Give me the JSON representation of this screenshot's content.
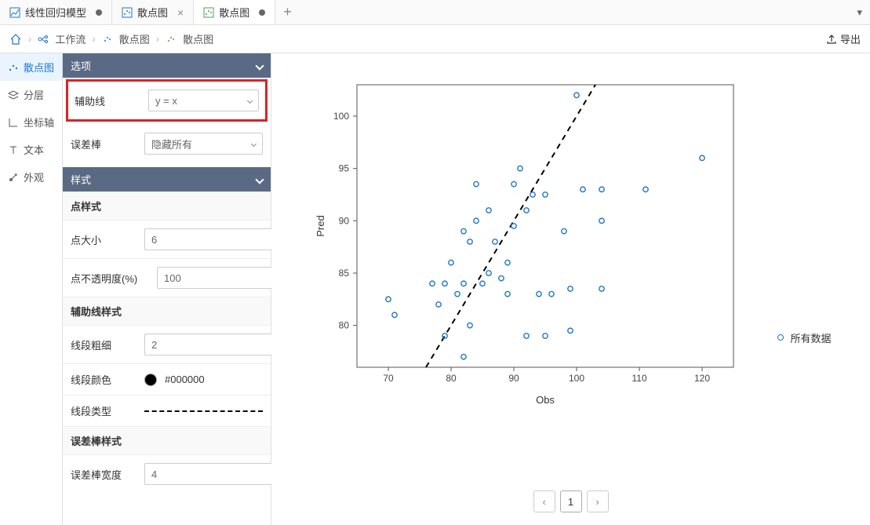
{
  "tabs": [
    {
      "label": "线性回归模型",
      "modified": true
    },
    {
      "label": "散点图",
      "closable": true
    },
    {
      "label": "散点图",
      "modified": true,
      "active": true
    }
  ],
  "breadcrumb": {
    "workflow": "工作流",
    "node1": "散点图",
    "node2": "散点图"
  },
  "export_label": "导出",
  "side_rail": {
    "items": [
      {
        "name": "scatter",
        "label": "散点图",
        "active": true
      },
      {
        "name": "layer",
        "label": "分层"
      },
      {
        "name": "axis",
        "label": "坐标轴"
      },
      {
        "name": "text",
        "label": "文本"
      },
      {
        "name": "appearance",
        "label": "外观"
      }
    ]
  },
  "options_panel": {
    "title": "选项",
    "ref_line": {
      "label": "辅助线",
      "value": "y = x"
    },
    "error_bar": {
      "label": "误差棒",
      "value": "隐藏所有"
    }
  },
  "style_panel": {
    "title": "样式",
    "point_style_header": "点样式",
    "point_size": {
      "label": "点大小",
      "value": "6"
    },
    "point_opacity": {
      "label": "点不透明度(%)",
      "value": "100"
    },
    "ref_line_style_header": "辅助线样式",
    "line_width": {
      "label": "线段粗细",
      "value": "2"
    },
    "line_color": {
      "label": "线段颜色",
      "value": "#000000"
    },
    "line_type": {
      "label": "线段类型"
    },
    "error_bar_style_header": "误差棒样式",
    "error_bar_width": {
      "label": "误差棒宽度",
      "value": "4"
    }
  },
  "chart_data": {
    "type": "scatter",
    "xlabel": "Obs",
    "ylabel": "Pred",
    "x_ticks": [
      70,
      80,
      90,
      100,
      110,
      120
    ],
    "y_ticks": [
      80,
      85,
      90,
      95,
      100
    ],
    "xlim": [
      65,
      125
    ],
    "ylim": [
      76,
      103
    ],
    "series": [
      {
        "name": "所有数据",
        "points": [
          [
            70,
            82.5
          ],
          [
            71,
            81
          ],
          [
            77,
            84
          ],
          [
            78,
            82
          ],
          [
            79,
            79
          ],
          [
            79,
            84
          ],
          [
            80,
            86
          ],
          [
            81,
            83
          ],
          [
            82,
            77
          ],
          [
            82,
            84
          ],
          [
            82,
            89
          ],
          [
            83,
            88
          ],
          [
            83,
            80
          ],
          [
            84,
            90
          ],
          [
            84,
            93.5
          ],
          [
            85,
            84
          ],
          [
            86,
            91
          ],
          [
            86,
            85
          ],
          [
            87,
            88
          ],
          [
            88,
            84.5
          ],
          [
            89,
            83
          ],
          [
            89,
            86
          ],
          [
            90,
            89.5
          ],
          [
            90,
            93.5
          ],
          [
            91,
            95
          ],
          [
            92,
            91
          ],
          [
            92,
            79
          ],
          [
            93,
            92.5
          ],
          [
            94,
            83
          ],
          [
            95,
            92.5
          ],
          [
            95,
            79
          ],
          [
            96,
            83
          ],
          [
            98,
            89
          ],
          [
            99,
            83.5
          ],
          [
            99,
            79.5
          ],
          [
            100,
            102
          ],
          [
            101,
            93
          ],
          [
            104,
            93
          ],
          [
            104,
            90
          ],
          [
            104,
            83.5
          ],
          [
            111,
            93
          ],
          [
            120,
            96
          ]
        ]
      }
    ],
    "ref_line": {
      "type": "y=x",
      "style": "dashed",
      "color": "#000"
    }
  },
  "legend": {
    "label": "所有数据"
  },
  "pager": {
    "current": "1"
  }
}
